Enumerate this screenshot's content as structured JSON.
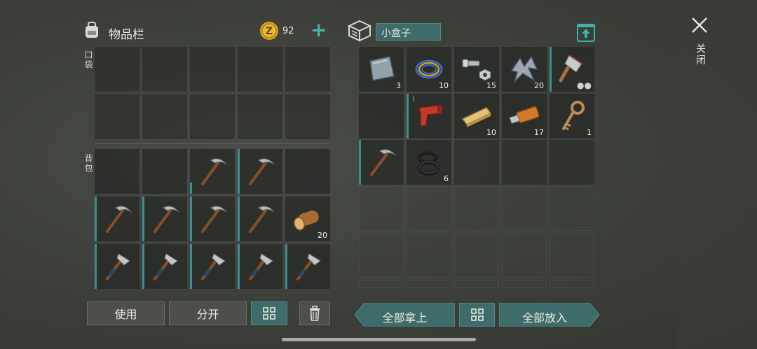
{
  "left_panel": {
    "title": "物品栏",
    "coins": "92",
    "add_label": "+",
    "pocket_label": "口袋",
    "backpack_label": "背包",
    "backpack_items": [
      {
        "slot": 2,
        "icon": "pickaxe-icon",
        "count": ""
      },
      {
        "slot": 3,
        "icon": "pickaxe-icon",
        "count": ""
      },
      {
        "slot": 5,
        "icon": "pickaxe-icon",
        "count": ""
      },
      {
        "slot": 6,
        "icon": "pickaxe-icon",
        "count": ""
      },
      {
        "slot": 7,
        "icon": "pickaxe-icon",
        "count": ""
      },
      {
        "slot": 8,
        "icon": "pickaxe-icon",
        "count": ""
      },
      {
        "slot": 9,
        "icon": "log-icon",
        "count": "20"
      },
      {
        "slot": 10,
        "icon": "hatchet-icon",
        "count": ""
      },
      {
        "slot": 11,
        "icon": "hatchet-icon",
        "count": ""
      },
      {
        "slot": 12,
        "icon": "hatchet-icon",
        "count": ""
      },
      {
        "slot": 13,
        "icon": "hatchet-icon",
        "count": ""
      },
      {
        "slot": 14,
        "icon": "hatchet-icon",
        "count": ""
      }
    ],
    "buttons": {
      "use": "使用",
      "split": "分开"
    }
  },
  "right_panel": {
    "title": "小盒子",
    "items": [
      {
        "slot": 0,
        "icon": "metal-sheet-icon",
        "count": "3"
      },
      {
        "slot": 1,
        "icon": "wire-coil-icon",
        "count": "10"
      },
      {
        "slot": 2,
        "icon": "nuts-bolts-icon",
        "count": "15"
      },
      {
        "slot": 3,
        "icon": "metal-scrap-icon",
        "count": "20"
      },
      {
        "slot": 4,
        "icon": "cleaver-icon",
        "count": ""
      },
      {
        "slot": 6,
        "icon": "flare-gun-icon",
        "count": ""
      },
      {
        "slot": 7,
        "icon": "plank-icon",
        "count": "10"
      },
      {
        "slot": 8,
        "icon": "usb-drive-icon",
        "count": "17"
      },
      {
        "slot": 9,
        "icon": "key-icon",
        "count": "1"
      },
      {
        "slot": 10,
        "icon": "pickaxe-icon",
        "count": ""
      },
      {
        "slot": 11,
        "icon": "rubber-rings-icon",
        "count": "6"
      }
    ],
    "buttons": {
      "take_all": "全部拿上",
      "put_all": "全部放入"
    }
  },
  "close_label": "关闭",
  "colors": {
    "accent_teal": "#3c8f8a",
    "coin_gold": "#d9a21b"
  }
}
